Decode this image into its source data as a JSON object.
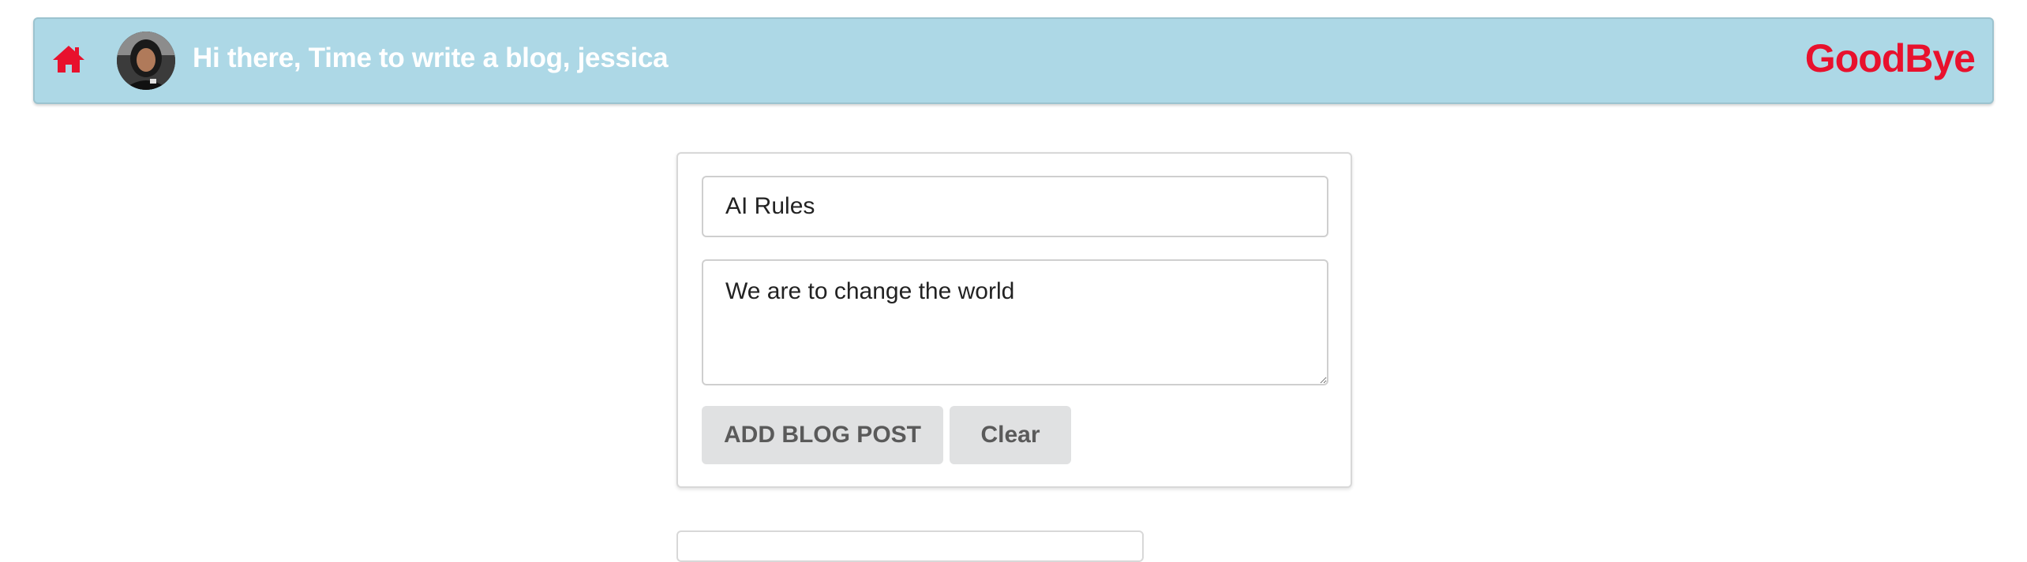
{
  "header": {
    "greeting": "Hi there, Time to write a blog, jessica",
    "logout_label": "GoodBye",
    "home_icon": "home-icon",
    "avatar_alt": "user avatar",
    "colors": {
      "bar": "#add8e6",
      "accent": "#e8112d",
      "greeting_text": "#ffffff"
    }
  },
  "form": {
    "title_value": "AI Rules",
    "body_value": "We are to change the world",
    "add_button_label": "ADD BLOG POST",
    "clear_button_label": "Clear"
  }
}
